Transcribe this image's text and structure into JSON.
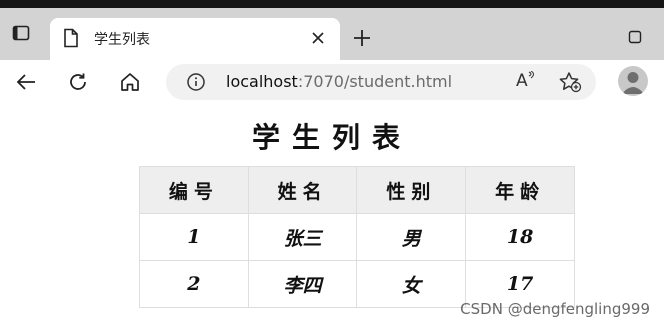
{
  "browser": {
    "tab": {
      "title": "学生列表"
    },
    "address": {
      "host": "localhost",
      "path": ":7070/student.html"
    },
    "icons": {
      "tab_switcher": "tab-switcher-icon",
      "document": "document-icon",
      "close": "close-icon",
      "new_tab": "plus-icon",
      "restore": "restore-window-icon",
      "back": "back-arrow-icon",
      "reload": "reload-icon",
      "home": "home-icon",
      "info": "info-icon",
      "read_aloud": "read-aloud-icon",
      "favorite": "add-favorite-icon",
      "profile": "profile-avatar-icon"
    },
    "read_aloud_glyph": "A"
  },
  "page": {
    "title": "学生列表",
    "table": {
      "headers": [
        "编号",
        "姓名",
        "性别",
        "年龄"
      ],
      "rows": [
        [
          "1",
          "张三",
          "男",
          "18"
        ],
        [
          "2",
          "李四",
          "女",
          "17"
        ]
      ]
    }
  },
  "watermark": "CSDN @dengfengling999",
  "colors": {
    "tabbar": "#d3d3d3",
    "header_row": "#eeeeee",
    "border": "#dedede"
  }
}
